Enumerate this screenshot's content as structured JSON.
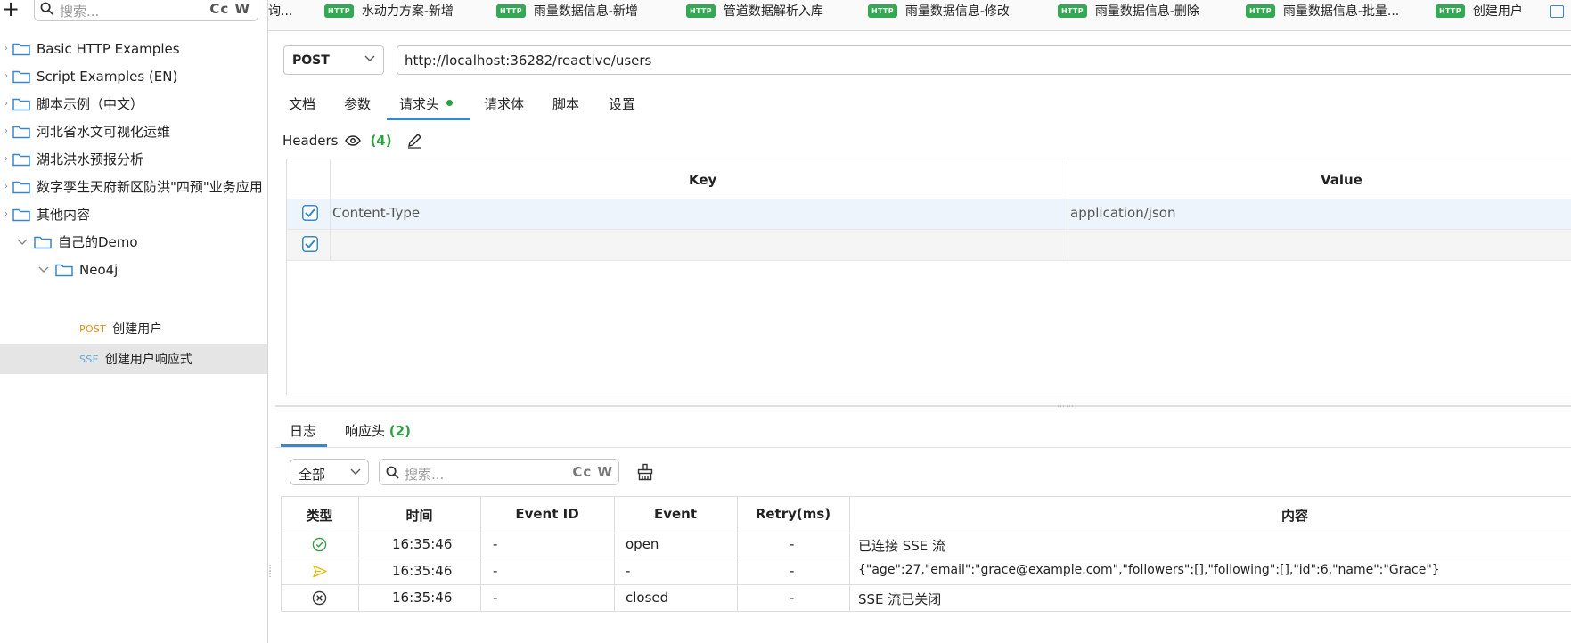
{
  "sidebar": {
    "search_placeholder": "搜索...",
    "search_options": "Cc W",
    "items": [
      {
        "label": "Basic HTTP Examples"
      },
      {
        "label": "Script Examples (EN)"
      },
      {
        "label": "脚本示例（中文）"
      },
      {
        "label": "河北省水文可视化运维"
      },
      {
        "label": "湖北洪水预报分析"
      },
      {
        "label": "数字孪生天府新区防洪\"四预\"业务应用"
      },
      {
        "label": "其他内容"
      },
      {
        "label": "自己的Demo"
      },
      {
        "label": "Neo4j"
      },
      {
        "method": "POST",
        "label": "创建用户"
      },
      {
        "method": "SSE",
        "label": "创建用户响应式"
      }
    ]
  },
  "tabs": [
    {
      "label": "询..."
    },
    {
      "badge": "HTTP",
      "label": "水动力方案-新增"
    },
    {
      "badge": "HTTP",
      "label": "雨量数据信息-新增"
    },
    {
      "badge": "HTTP",
      "label": "管道数据解析入库"
    },
    {
      "badge": "HTTP",
      "label": "雨量数据信息-修改"
    },
    {
      "badge": "HTTP",
      "label": "雨量数据信息-删除"
    },
    {
      "badge": "HTTP",
      "label": "雨量数据信息-批量..."
    },
    {
      "badge": "HTTP",
      "label": "创建用户"
    }
  ],
  "request": {
    "method": "POST",
    "url": "http://localhost:36282/reactive/users",
    "tabs": [
      "文档",
      "参数",
      "请求头",
      "请求体",
      "脚本",
      "设置"
    ],
    "headers_label": "Headers",
    "headers_count": "(4)"
  },
  "headers_table": {
    "columns": [
      "Key",
      "Value"
    ],
    "rows": [
      {
        "checked": true,
        "key": "Content-Type",
        "value": "application/json"
      },
      {
        "checked": true,
        "key": "",
        "value": ""
      }
    ]
  },
  "response": {
    "tabs": [
      "日志",
      "响应头"
    ],
    "headers_count": "(2)",
    "filter": "全部",
    "search_placeholder": "搜索...",
    "search_options": "Cc W"
  },
  "log_table": {
    "columns": [
      "类型",
      "时间",
      "Event ID",
      "Event",
      "Retry(ms)",
      "内容"
    ],
    "rows": [
      {
        "type_icon": "check-circle-icon",
        "time": "16:35:46",
        "event_id": "-",
        "event": "open",
        "retry": "-",
        "content": "已连接 SSE 流"
      },
      {
        "type_icon": "send-icon",
        "time": "16:35:46",
        "event_id": "-",
        "event": "-",
        "retry": "-",
        "content": "{\"age\":27,\"email\":\"grace@example.com\",\"followers\":[],\"following\":[],\"id\":6,\"name\":\"Grace\"}"
      },
      {
        "type_icon": "close-circle-icon",
        "time": "16:35:46",
        "event_id": "-",
        "event": "closed",
        "retry": "-",
        "content": "SSE 流已关闭"
      }
    ]
  },
  "colors": {
    "accent": "#3a86c8",
    "http_badge": "#34a853",
    "count_green": "#2f9e44",
    "post": "#e8910b",
    "sse": "#5fa8d3",
    "selected_row": "#e5e5e5"
  }
}
